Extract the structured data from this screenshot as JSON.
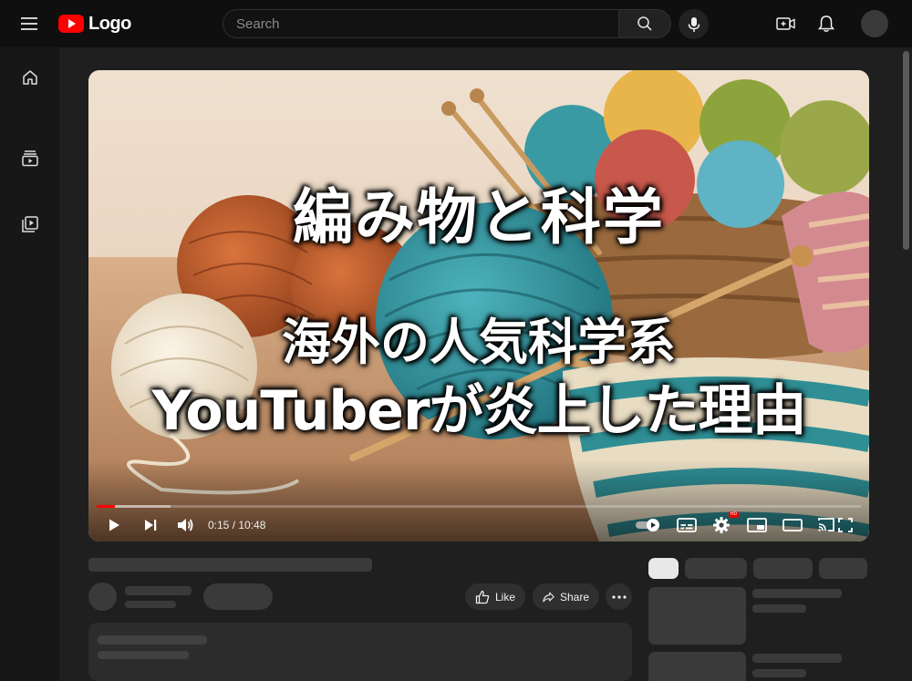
{
  "header": {
    "logo_text": "Logo",
    "search_placeholder": "Search",
    "icons": [
      "menu-icon",
      "search-icon",
      "microphone-icon",
      "create-video-icon",
      "bell-icon"
    ]
  },
  "sidebar": {
    "items": [
      {
        "icon": "home-icon"
      },
      {
        "icon": "subscriptions-icon"
      },
      {
        "icon": "library-icon"
      }
    ]
  },
  "player": {
    "title_line1": "編み物と科学",
    "title_line2": "海外の人気科学系",
    "title_line3": "YouTuberが炎上した理由",
    "current_time": "0:15",
    "separator": " / ",
    "duration": "10:48",
    "progress": 0.024,
    "buffered": 0.097,
    "hd_badge": "HD",
    "controls": [
      "play-icon",
      "next-icon",
      "volume-icon",
      "autoplay-toggle",
      "subtitles-icon",
      "settings-icon",
      "miniplayer-icon",
      "theater-icon",
      "cast-fullscreen-icon"
    ]
  },
  "actions": {
    "like_label": "Like",
    "share_label": "Share"
  },
  "colors": {
    "accent": "#ff0000",
    "background": "#0f0f0f",
    "surface": "#1f1f1f"
  }
}
